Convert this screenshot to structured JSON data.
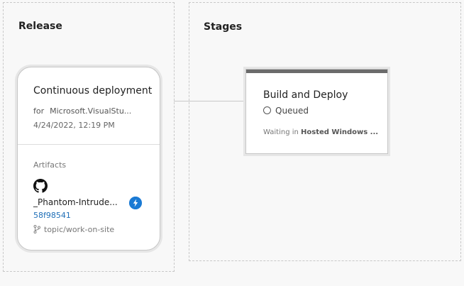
{
  "release": {
    "title": "Release",
    "card": {
      "heading": "Continuous deployment",
      "for_label": "for",
      "for_value": "Microsoft.VisualStu...",
      "date": "4/24/2022, 12:19 PM",
      "artifacts_label": "Artifacts",
      "artifact_name": "_Phantom-Intrude...",
      "commit": "58f98541",
      "branch": "topic/work-on-site"
    }
  },
  "stages": {
    "title": "Stages",
    "items": [
      {
        "name": "Build and Deploy",
        "status": "Queued",
        "waiting_prefix": "Waiting in ",
        "waiting_target": "Hosted Windows ..."
      }
    ]
  },
  "colors": {
    "accent": "#1a7ad4",
    "link": "#1f6fb7",
    "stage_bar": "#6b6b6b"
  },
  "icons": {
    "artifact_source": "github-icon",
    "trigger": "lightning-icon",
    "branch": "branch-icon",
    "status": "queued-circle-icon"
  }
}
